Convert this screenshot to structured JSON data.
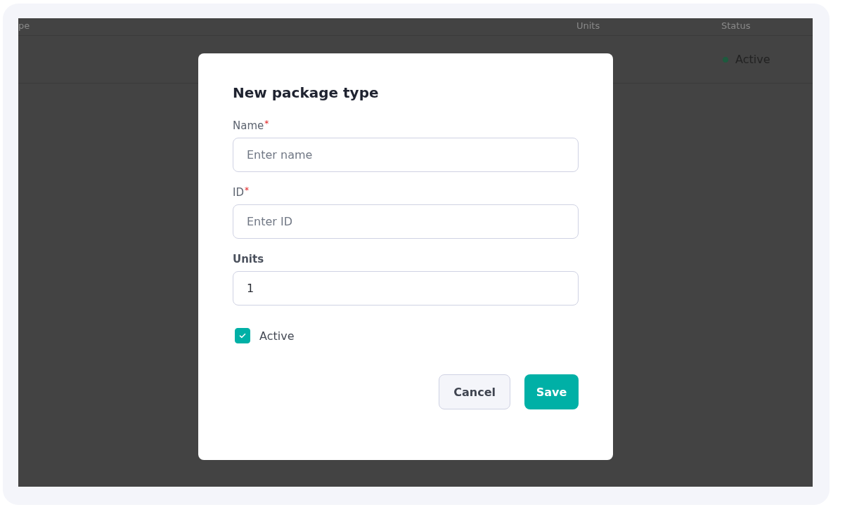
{
  "background_table": {
    "columns": [
      "pe",
      "Units",
      "Status"
    ],
    "rows": [
      {
        "status": {
          "label": "Active",
          "color": "#1d5a3e"
        }
      }
    ]
  },
  "dialog": {
    "title": "New package type",
    "fields": [
      {
        "label": "Name",
        "required_mark": "*",
        "placeholder": "Enter name"
      },
      {
        "label": "ID",
        "required_mark": "*",
        "placeholder": "Enter ID"
      },
      {
        "label": "Units",
        "value": "1"
      }
    ],
    "active": {
      "label": "Active",
      "checked": true
    },
    "buttons": [
      {
        "label": "Cancel",
        "kind": "secondary"
      },
      {
        "label": "Save",
        "kind": "primary"
      }
    ]
  }
}
